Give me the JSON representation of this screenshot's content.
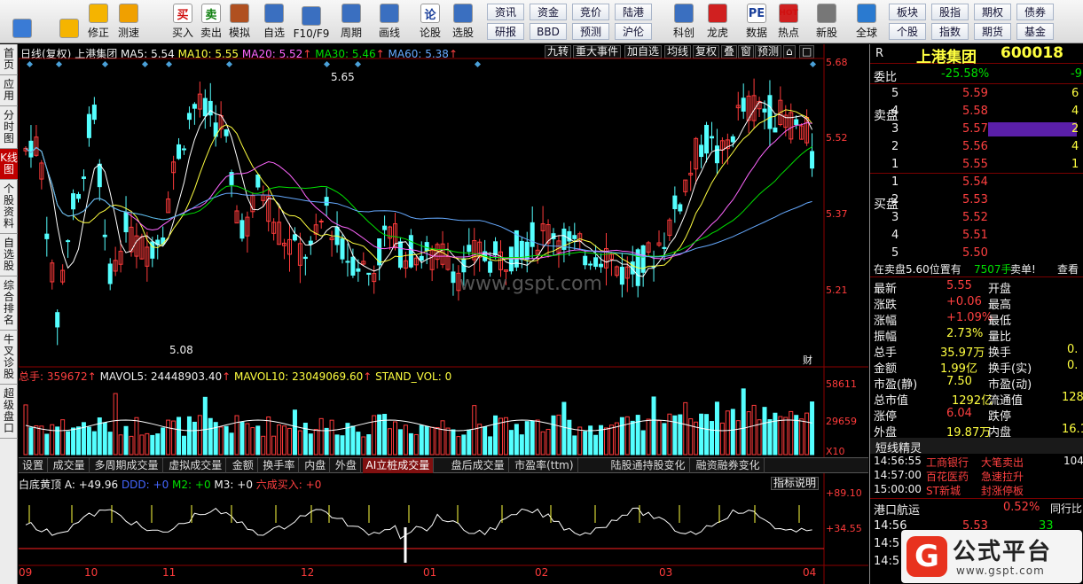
{
  "toolbar": {
    "large": [
      {
        "name": "home-button",
        "icon": "grid-icon",
        "label": ""
      },
      {
        "name": "back-button",
        "icon": "back-arrow-icon",
        "label": ""
      },
      {
        "name": "restore-button",
        "icon": "restore-icon",
        "label": "修正"
      },
      {
        "name": "backtest-button",
        "icon": "clock-icon",
        "label": "测速"
      },
      {
        "name": "buy-button",
        "icon": "buy-icon",
        "label": "买入",
        "glyph": "买"
      },
      {
        "name": "sell-button",
        "icon": "sell-icon",
        "label": "卖出",
        "glyph": "卖"
      },
      {
        "name": "simulate-button",
        "icon": "hammer-icon",
        "label": "模拟"
      },
      {
        "name": "watchlist-button",
        "icon": "star-icon",
        "label": "自选"
      },
      {
        "name": "f10-button",
        "icon": "document-icon",
        "label": "F10/F9"
      },
      {
        "name": "period-button",
        "icon": "period-icon",
        "label": "周期"
      },
      {
        "name": "draw-button",
        "icon": "pencil-icon",
        "label": "画线"
      },
      {
        "name": "stock-forum-button",
        "icon": "forum-icon",
        "label": "论股",
        "glyph": "论"
      },
      {
        "name": "stock-picker-button",
        "icon": "magnifier-icon",
        "label": "选股"
      },
      {
        "name": "sci-tech-button",
        "icon": "sci-tech-icon",
        "label": "科创"
      },
      {
        "name": "dragon-tiger-button",
        "icon": "dragon-icon",
        "label": "龙虎"
      },
      {
        "name": "data-button",
        "icon": "pe-icon",
        "label": "数据",
        "glyph": "PE"
      },
      {
        "name": "hotspot-button",
        "icon": "hot-icon",
        "label": "热点",
        "glyph": "HOT"
      },
      {
        "name": "new-stock-button",
        "icon": "new-stock-icon",
        "label": "新股"
      },
      {
        "name": "global-button",
        "icon": "globe-icon",
        "label": "全球"
      }
    ],
    "small": [
      [
        "资讯",
        "资金",
        "竞价",
        "陆港"
      ],
      [
        "研报",
        "BBD",
        "预测",
        "沪伦"
      ],
      [
        "板块",
        "股指",
        "期权",
        "债券"
      ],
      [
        "个股",
        "指数",
        "期货",
        "基金"
      ]
    ]
  },
  "sidebar": [
    "首页",
    "应用",
    "分时图",
    "K线图",
    "个股资料",
    "自选股",
    "综合排名",
    "牛叉诊股",
    "超级盘口"
  ],
  "chart": {
    "header": {
      "type": "日线(复权)",
      "stock": "上港集团",
      "ma5": "MA5: 5.54",
      "ma10": "MA10: 5.55",
      "ma20": "MA20: 5.52",
      "ma30": "MA30: 5.46",
      "ma60": "MA60: 5.38"
    },
    "buttons": [
      "九转",
      "重大事件",
      "加自选",
      "均线",
      "复权",
      "叠",
      "窗",
      "预测"
    ],
    "price_axis": [
      "5.68",
      "5.52",
      "5.37",
      "5.21"
    ],
    "hi_label": "5.65",
    "lo_label": "5.08",
    "cai_label": "财",
    "watermark": "www.gspt.com",
    "vol_header": {
      "total": "总手: 359672",
      "mavol5": "MAVOL5: 24448903.40",
      "mavol10": "MAVOL10: 23049069.60",
      "stand": "STAND_VOL: 0"
    },
    "vol_axis": [
      "58611",
      "29659",
      "X10"
    ],
    "tabs": [
      "设置",
      "成交量",
      "多周期成交量",
      "虚拟成交量",
      "金额",
      "换手率",
      "内盘",
      "外盘",
      "AI立桩成交量",
      "盘后成交量",
      "市盈率(ttm)",
      "陆股通持股变化",
      "融资融券变化"
    ],
    "active_tab": "AI立桩成交量",
    "ind_header": {
      "name": "白底黄顶",
      "a": "A: +49.96",
      "ddd": "DDD: +0",
      "m2": "M2: +0",
      "m3": "M3: +0",
      "buy": "六成买入: +0"
    },
    "ind_help": "指标说明",
    "ind_axis": [
      "+89.10",
      "+34.55"
    ],
    "months": [
      "09",
      "10",
      "11",
      "12",
      "01",
      "02",
      "03",
      "04"
    ]
  },
  "right": {
    "r": "R",
    "name": "上港集团",
    "code": "600018",
    "wb_label": "委比",
    "wb_value": "-25.58%",
    "wb_extra": "-9",
    "sell_title": "卖盘",
    "buy_title": "买盘",
    "sell": [
      [
        "5",
        "5.59",
        "6"
      ],
      [
        "4",
        "5.58",
        "4"
      ],
      [
        "3",
        "5.57",
        "2"
      ],
      [
        "2",
        "5.56",
        "4"
      ],
      [
        "1",
        "5.55",
        "1"
      ]
    ],
    "buy": [
      [
        "1",
        "5.54",
        ""
      ],
      [
        "2",
        "5.53",
        ""
      ],
      [
        "3",
        "5.52",
        ""
      ],
      [
        "4",
        "5.51",
        ""
      ],
      [
        "5",
        "5.50",
        ""
      ]
    ],
    "notice": {
      "text": "在卖盘5.60位置有",
      "vol": "7507手",
      "word": "卖单!",
      "link": "查看"
    },
    "stats": [
      [
        "最新",
        "5.55",
        "开盘",
        ""
      ],
      [
        "涨跌",
        "+0.06",
        "最高",
        ""
      ],
      [
        "涨幅",
        "+1.09%",
        "最低",
        ""
      ],
      [
        "振幅",
        "2.73%",
        "量比",
        ""
      ],
      [
        "总手",
        "35.97万",
        "换手",
        "0."
      ],
      [
        "金额",
        "1.99亿",
        "换手(实)",
        "0."
      ],
      [
        "市盈(静)",
        "7.50",
        "市盈(动)",
        ""
      ],
      [
        "总市值",
        "1292亿",
        "流通值",
        "128"
      ],
      [
        "涨停",
        "6.04",
        "跌停",
        ""
      ],
      [
        "外盘",
        "19.87万",
        "内盘",
        "16.1"
      ]
    ],
    "short_title": "短线精灵",
    "short": [
      [
        "14:56:55",
        "工商银行",
        "大笔卖出",
        "104"
      ],
      [
        "14:57:00",
        "百花医药",
        "急速拉升",
        ""
      ],
      [
        "15:00:00",
        "ST新城",
        "封涨停板",
        ""
      ]
    ],
    "port": {
      "name": "港口航运",
      "pct": "0.52%",
      "more": "同行比"
    },
    "ticks": [
      [
        "14:56",
        "5.53",
        "33"
      ],
      [
        "14:5",
        "",
        ""
      ],
      [
        "14:5",
        "",
        ""
      ]
    ],
    "logo": {
      "cn": "公式平台",
      "url": "www.gspt.com"
    }
  },
  "colors": {
    "up": "#ff3b3b",
    "down": "#54ffff",
    "accent": "#c00000"
  }
}
